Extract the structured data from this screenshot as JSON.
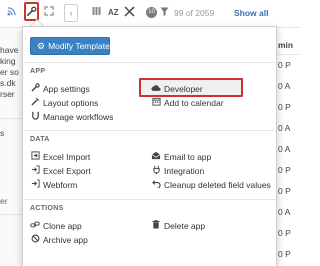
{
  "toolbar": {
    "rss_icon": "rss-icon",
    "wrench_icon": "wrench-icon",
    "expand_icon": "expand-icon",
    "back_glyph": "‹",
    "columns_icon": "columns-icon",
    "sort_label": "AZ",
    "tools_icon": "tools-icon",
    "badge": "10",
    "filter_icon": "filter-icon",
    "record_count": "99 of 2059",
    "show_all": "Show all",
    "highlight_color": "#d0312d"
  },
  "background_left": {
    "lines": [
      "have",
      "king",
      "er so",
      "s.dk",
      "rser"
    ],
    "lower": [
      "s",
      "er"
    ]
  },
  "background_right": {
    "header": "min",
    "rows": [
      "0 P",
      "0 A",
      "0 P",
      "0 A",
      "0 A",
      "0 P",
      "0 P",
      "0 A",
      "0 P",
      "0 P"
    ]
  },
  "menu": {
    "primary_button": "Modify Template",
    "primary_color": "#3a80c2",
    "sections": {
      "app": "APP",
      "data": "DATA",
      "actions": "ACTIONS"
    },
    "app_left": [
      {
        "label": "App settings",
        "icon": "wrench-icon"
      },
      {
        "label": "Layout options",
        "icon": "layout-icon"
      },
      {
        "label": "Manage workflows",
        "icon": "workflow-icon"
      }
    ],
    "app_right": [
      {
        "label": "Developer",
        "icon": "cloud-icon"
      },
      {
        "label": "Add to calendar",
        "icon": "calendar-icon"
      }
    ],
    "data_left": [
      {
        "label": "Excel Import",
        "icon": "import-icon"
      },
      {
        "label": "Excel Export",
        "icon": "export-icon"
      },
      {
        "label": "Webform",
        "icon": "webform-icon"
      }
    ],
    "data_right": [
      {
        "label": "Email to app",
        "icon": "email-icon"
      },
      {
        "label": "Integration",
        "icon": "integration-icon"
      },
      {
        "label": "Cleanup deleted field values",
        "icon": "undo-icon"
      }
    ],
    "actions_left": [
      {
        "label": "Clone app",
        "icon": "clone-icon"
      },
      {
        "label": "Archive app",
        "icon": "archive-icon"
      }
    ],
    "actions_right": [
      {
        "label": "Delete app",
        "icon": "trash-icon"
      }
    ]
  }
}
